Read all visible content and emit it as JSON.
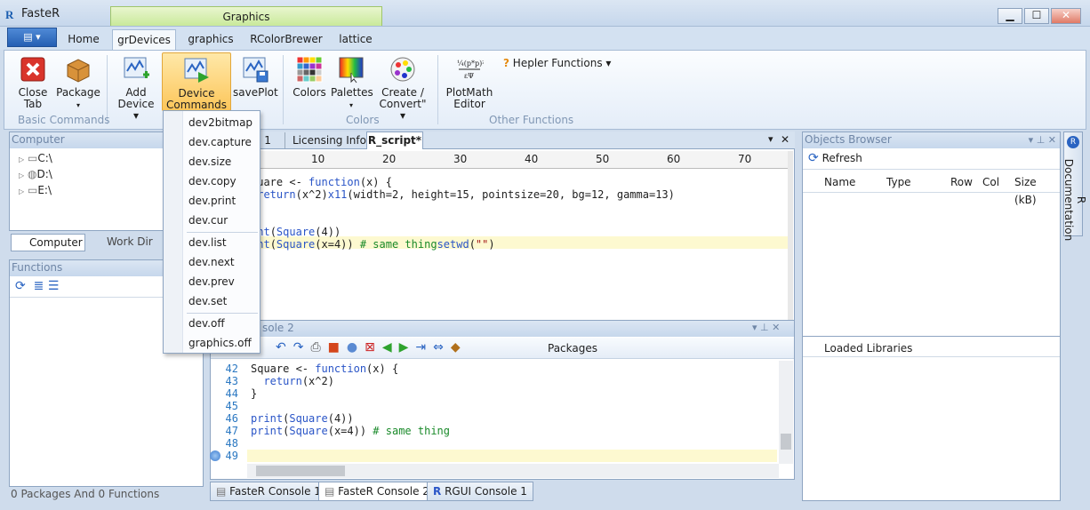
{
  "app": {
    "title": "FasteR",
    "logo": "R"
  },
  "context_tab": "Graphics",
  "window": {
    "min": "▁",
    "max": "☐",
    "close": "✕"
  },
  "ribbon_tabs": [
    "Home",
    "grDevices",
    "graphics",
    "RColorBrewer",
    "lattice"
  ],
  "ribbon": {
    "close_tab": "Close\nTab",
    "package": "Package",
    "add_device": "Add\nDevice ▾",
    "device_commands": "Device\nCommands ▾",
    "save_plot": "savePlot",
    "colors": "Colors",
    "palettes": "Palettes",
    "create_convert": "Create /\nConvert\" ▾",
    "plotmath": "PlotMath\nEditor",
    "helper": "Hepler Functions ▾",
    "groups": {
      "basic": "Basic Commands",
      "colors": "Colors",
      "other": "Other Functions"
    }
  },
  "device_commands_menu": [
    "dev2bitmap",
    "dev.capture",
    "dev.size",
    "dev.copy",
    "dev.print",
    "dev.cur",
    "dev.list",
    "dev.next",
    "dev.prev",
    "dev.set",
    "dev.off",
    "graphics.off"
  ],
  "computer_panel": {
    "header": "Computer",
    "drives": [
      "C:\\",
      "D:\\",
      "E:\\"
    ],
    "tabs": [
      "Computer",
      "Work Dir"
    ]
  },
  "functions_panel": {
    "header": "Functions"
  },
  "status": "0  Packages  And  0  Functions",
  "editor": {
    "tabs": [
      "e 1",
      "Licensing Info",
      "R_script*"
    ],
    "ruler": [
      "10",
      "20",
      "30",
      "40",
      "50",
      "60",
      "70"
    ]
  },
  "console": {
    "header": "sole 2",
    "packages_label": "Packages",
    "line_numbers": [
      "42",
      "43",
      "44",
      "45",
      "46",
      "47",
      "48",
      "49"
    ],
    "bottom_tabs": [
      "FasteR Console 1",
      "FasteR Console 2",
      "RGUI Console 1"
    ]
  },
  "objects_browser": {
    "header": "Objects Browser",
    "refresh": "Refresh",
    "columns": [
      "Name",
      "Type",
      "Row",
      "Col",
      "Size (kB)"
    ],
    "loaded_libraries": "Loaded Libraries"
  },
  "side_tab": "R Documentation"
}
